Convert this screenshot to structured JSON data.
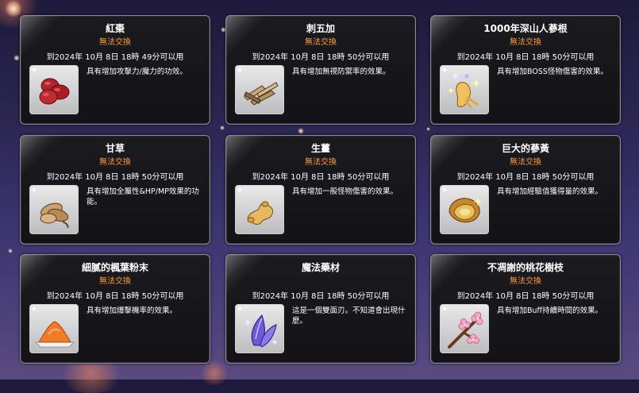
{
  "cards": [
    {
      "name": "紅棗",
      "trade": "無法交換",
      "expire": "到2024年 10月 8日 18時 49分可以用",
      "desc": "具有增加攻擊力/魔力的功效。",
      "icon": "jujube-icon"
    },
    {
      "name": "刺五加",
      "trade": "無法交換",
      "expire": "到2024年 10月 8日 18時 50分可以用",
      "desc": "具有增加無視防禦率的效果。",
      "icon": "acanthopanax-icon"
    },
    {
      "name": "1000年深山人蔘根",
      "trade": "無法交換",
      "expire": "到2024年 10月 8日 18時 50分可以用",
      "desc": "具有增加BOSS怪物傷害的效果。",
      "icon": "ginseng-root-icon"
    },
    {
      "name": "甘草",
      "trade": "無法交換",
      "expire": "到2024年 10月 8日 18時 50分可以用",
      "desc": "具有增加全屬性&HP/MP效果的功能。",
      "icon": "licorice-icon"
    },
    {
      "name": "生薑",
      "trade": "無法交換",
      "expire": "到2024年 10月 8日 18時 50分可以用",
      "desc": "具有增加一般怪物傷害的效果。",
      "icon": "ginger-icon"
    },
    {
      "name": "巨大的蔘黃",
      "trade": "無法交換",
      "expire": "到2024年 10月 8日 18時 50分可以用",
      "desc": "具有增加經驗值獲得量的效果。",
      "icon": "mushroom-icon"
    },
    {
      "name": "細膩的楓葉粉末",
      "trade": "無法交換",
      "expire": "到2024年 10月 8日 18時 50分可以用",
      "desc": "具有增加爆擊機率的效果。",
      "icon": "maple-powder-icon"
    },
    {
      "name": "魔法藥材",
      "trade": "",
      "expire": "到2024年 10月 8日 18時 50分可以用",
      "desc": "這是一個雙面刃。不知道會出現什麼。",
      "icon": "magic-herb-icon"
    },
    {
      "name": "不凋謝的桃花樹枝",
      "trade": "無法交換",
      "expire": "到2024年 10月 8日 18時 50分可以用",
      "desc": "具有增加Buff持續時間的效果。",
      "icon": "peach-blossom-icon"
    }
  ],
  "colors": {
    "trade": "#ff9a3c",
    "card_bg": "#151519",
    "border": "#8a8a92"
  }
}
